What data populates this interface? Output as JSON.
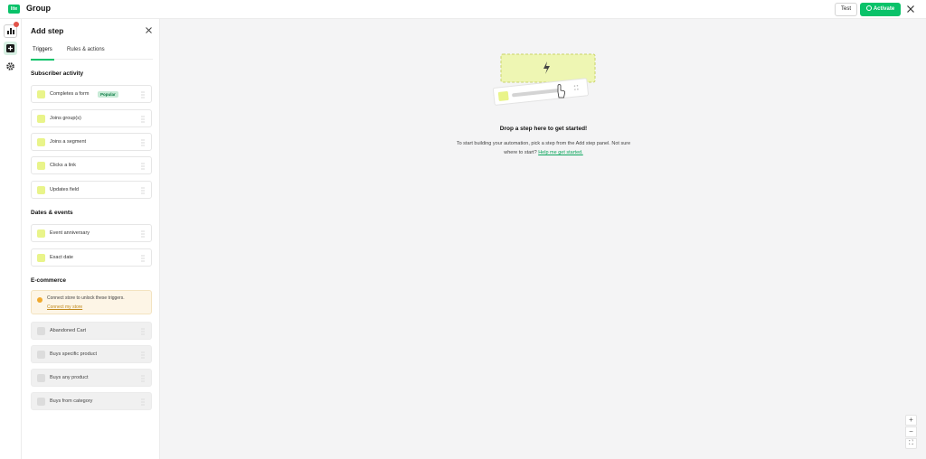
{
  "app": {
    "logo": "lite",
    "title": "Group"
  },
  "header": {
    "test_label": "Test",
    "activate_label": "Activate"
  },
  "rail": {
    "icons": [
      "chart-icon",
      "add-step-icon",
      "gear-icon"
    ]
  },
  "panel": {
    "title": "Add step",
    "tabs": [
      "Triggers",
      "Rules & actions"
    ],
    "sections": {
      "subscriber": "Subscriber activity",
      "dates": "Dates & events",
      "ecommerce": "E-commerce"
    },
    "subscriber_items": [
      "Completes a form",
      "Joins group(s)",
      "Joins a segment",
      "Clicks a link",
      "Updates field"
    ],
    "popular_badge": "Popular",
    "date_items": [
      "Event anniversary",
      "Exact date"
    ],
    "notice": {
      "text": "Connect store to unlock these triggers.",
      "link": "Connect my store"
    },
    "ecommerce_items": [
      "Abandoned Cart",
      "Buys specific product",
      "Buys any product",
      "Buys from category"
    ]
  },
  "canvas": {
    "title": "Drop a step here to get started!",
    "description": "To start building your automation, pick a step from the Add step panel. Not sure where to start?",
    "link": "Help me get started.",
    "zoom": [
      "+",
      "−",
      "⛶"
    ]
  },
  "colors": {
    "brand": "#09c269",
    "accent_yellow": "#e9f48a",
    "notice_bg": "#fdf5e6",
    "badge_red": "#e2544a"
  }
}
